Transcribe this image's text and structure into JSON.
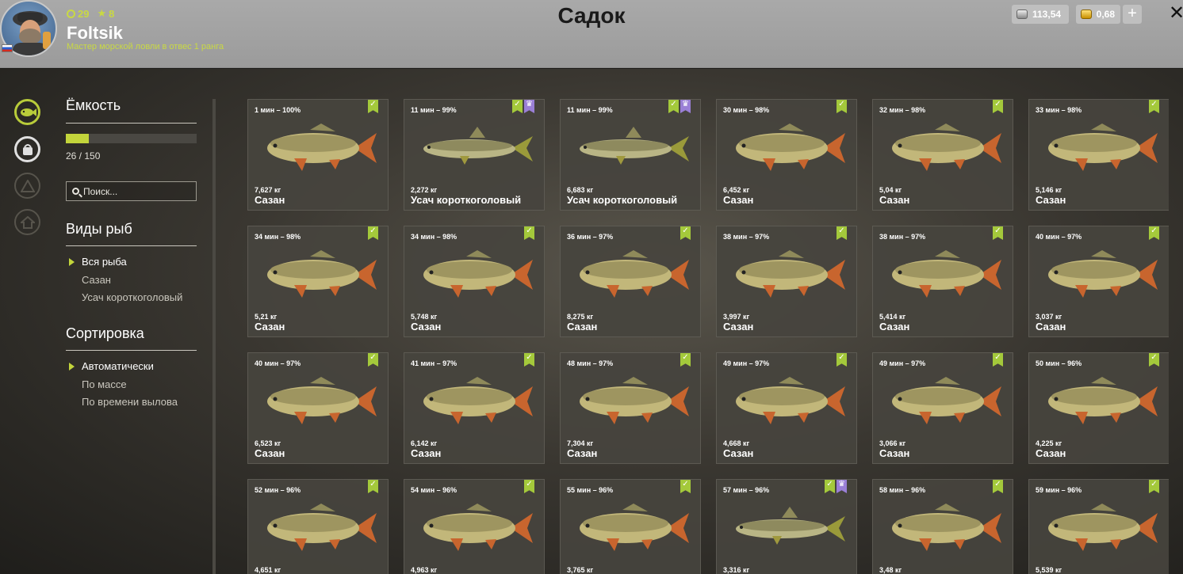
{
  "player": {
    "level": "29",
    "stars": "8",
    "name": "Foltsik",
    "rank": "Мастер морской ловли в отвес 1 ранга"
  },
  "title": "Садок",
  "currency": {
    "silver": "113,54",
    "gold": "0,68"
  },
  "sidebar": {
    "capacity_title": "Ёмкость",
    "capacity_text": "26 / 150",
    "capacity_fraction": 0.1733,
    "search_placeholder": "Поиск...",
    "species_title": "Виды рыб",
    "species": [
      "Вся рыба",
      "Сазан",
      "Усач короткоголовый"
    ],
    "species_selected": 0,
    "sort_title": "Сортировка",
    "sort": [
      "Автоматически",
      "По массе",
      "По времени вылова"
    ],
    "sort_selected": 0
  },
  "colors": {
    "accent": "#c3d53b",
    "badge_check": "#a4c93b",
    "badge_trophy": "#9a7fd6",
    "card_bg": "#46443e"
  },
  "icons": {
    "nav": [
      "fish-icon",
      "bucket-icon",
      "tent-icon",
      "home-icon"
    ],
    "badges": {
      "check": "bookmark-check-icon",
      "trophy": "bookmark-trophy-icon"
    }
  },
  "fish": [
    {
      "time": "1 мин – 100%",
      "weight": "7,627 кг",
      "name": "Сазан",
      "kind": "carp",
      "trophy": false
    },
    {
      "time": "11 мин – 99%",
      "weight": "2,272 кг",
      "name": "Усач короткоголовый",
      "kind": "barbel",
      "trophy": true
    },
    {
      "time": "11 мин – 99%",
      "weight": "6,683 кг",
      "name": "Усач короткоголовый",
      "kind": "barbel",
      "trophy": true
    },
    {
      "time": "30 мин – 98%",
      "weight": "6,452 кг",
      "name": "Сазан",
      "kind": "carp",
      "trophy": false
    },
    {
      "time": "32 мин – 98%",
      "weight": "5,04 кг",
      "name": "Сазан",
      "kind": "carp",
      "trophy": false
    },
    {
      "time": "33 мин – 98%",
      "weight": "5,146 кг",
      "name": "Сазан",
      "kind": "carp",
      "trophy": false
    },
    {
      "time": "34 мин – 98%",
      "weight": "5,21 кг",
      "name": "Сазан",
      "kind": "carp",
      "trophy": false
    },
    {
      "time": "34 мин – 98%",
      "weight": "5,748 кг",
      "name": "Сазан",
      "kind": "carp",
      "trophy": false
    },
    {
      "time": "36 мин – 97%",
      "weight": "8,275 кг",
      "name": "Сазан",
      "kind": "carp",
      "trophy": false
    },
    {
      "time": "38 мин – 97%",
      "weight": "3,997 кг",
      "name": "Сазан",
      "kind": "carp",
      "trophy": false
    },
    {
      "time": "38 мин – 97%",
      "weight": "5,414 кг",
      "name": "Сазан",
      "kind": "carp",
      "trophy": false
    },
    {
      "time": "40 мин – 97%",
      "weight": "3,037 кг",
      "name": "Сазан",
      "kind": "carp",
      "trophy": false
    },
    {
      "time": "40 мин – 97%",
      "weight": "6,523 кг",
      "name": "Сазан",
      "kind": "carp",
      "trophy": false
    },
    {
      "time": "41 мин – 97%",
      "weight": "6,142 кг",
      "name": "Сазан",
      "kind": "carp",
      "trophy": false
    },
    {
      "time": "48 мин – 97%",
      "weight": "7,304 кг",
      "name": "Сазан",
      "kind": "carp",
      "trophy": false
    },
    {
      "time": "49 мин – 97%",
      "weight": "4,668 кг",
      "name": "Сазан",
      "kind": "carp",
      "trophy": false
    },
    {
      "time": "49 мин – 97%",
      "weight": "3,066 кг",
      "name": "Сазан",
      "kind": "carp",
      "trophy": false
    },
    {
      "time": "50 мин – 96%",
      "weight": "4,225 кг",
      "name": "Сазан",
      "kind": "carp",
      "trophy": false
    },
    {
      "time": "52 мин – 96%",
      "weight": "4,651 кг",
      "name": "",
      "kind": "carp",
      "trophy": false
    },
    {
      "time": "54 мин – 96%",
      "weight": "4,963 кг",
      "name": "",
      "kind": "carp",
      "trophy": false
    },
    {
      "time": "55 мин – 96%",
      "weight": "3,765 кг",
      "name": "",
      "kind": "carp",
      "trophy": false
    },
    {
      "time": "57 мин – 96%",
      "weight": "3,316 кг",
      "name": "",
      "kind": "barbel",
      "trophy": true
    },
    {
      "time": "58 мин – 96%",
      "weight": "3,48 кг",
      "name": "",
      "kind": "carp",
      "trophy": false
    },
    {
      "time": "59 мин – 96%",
      "weight": "5,539 кг",
      "name": "",
      "kind": "carp",
      "trophy": false
    }
  ]
}
